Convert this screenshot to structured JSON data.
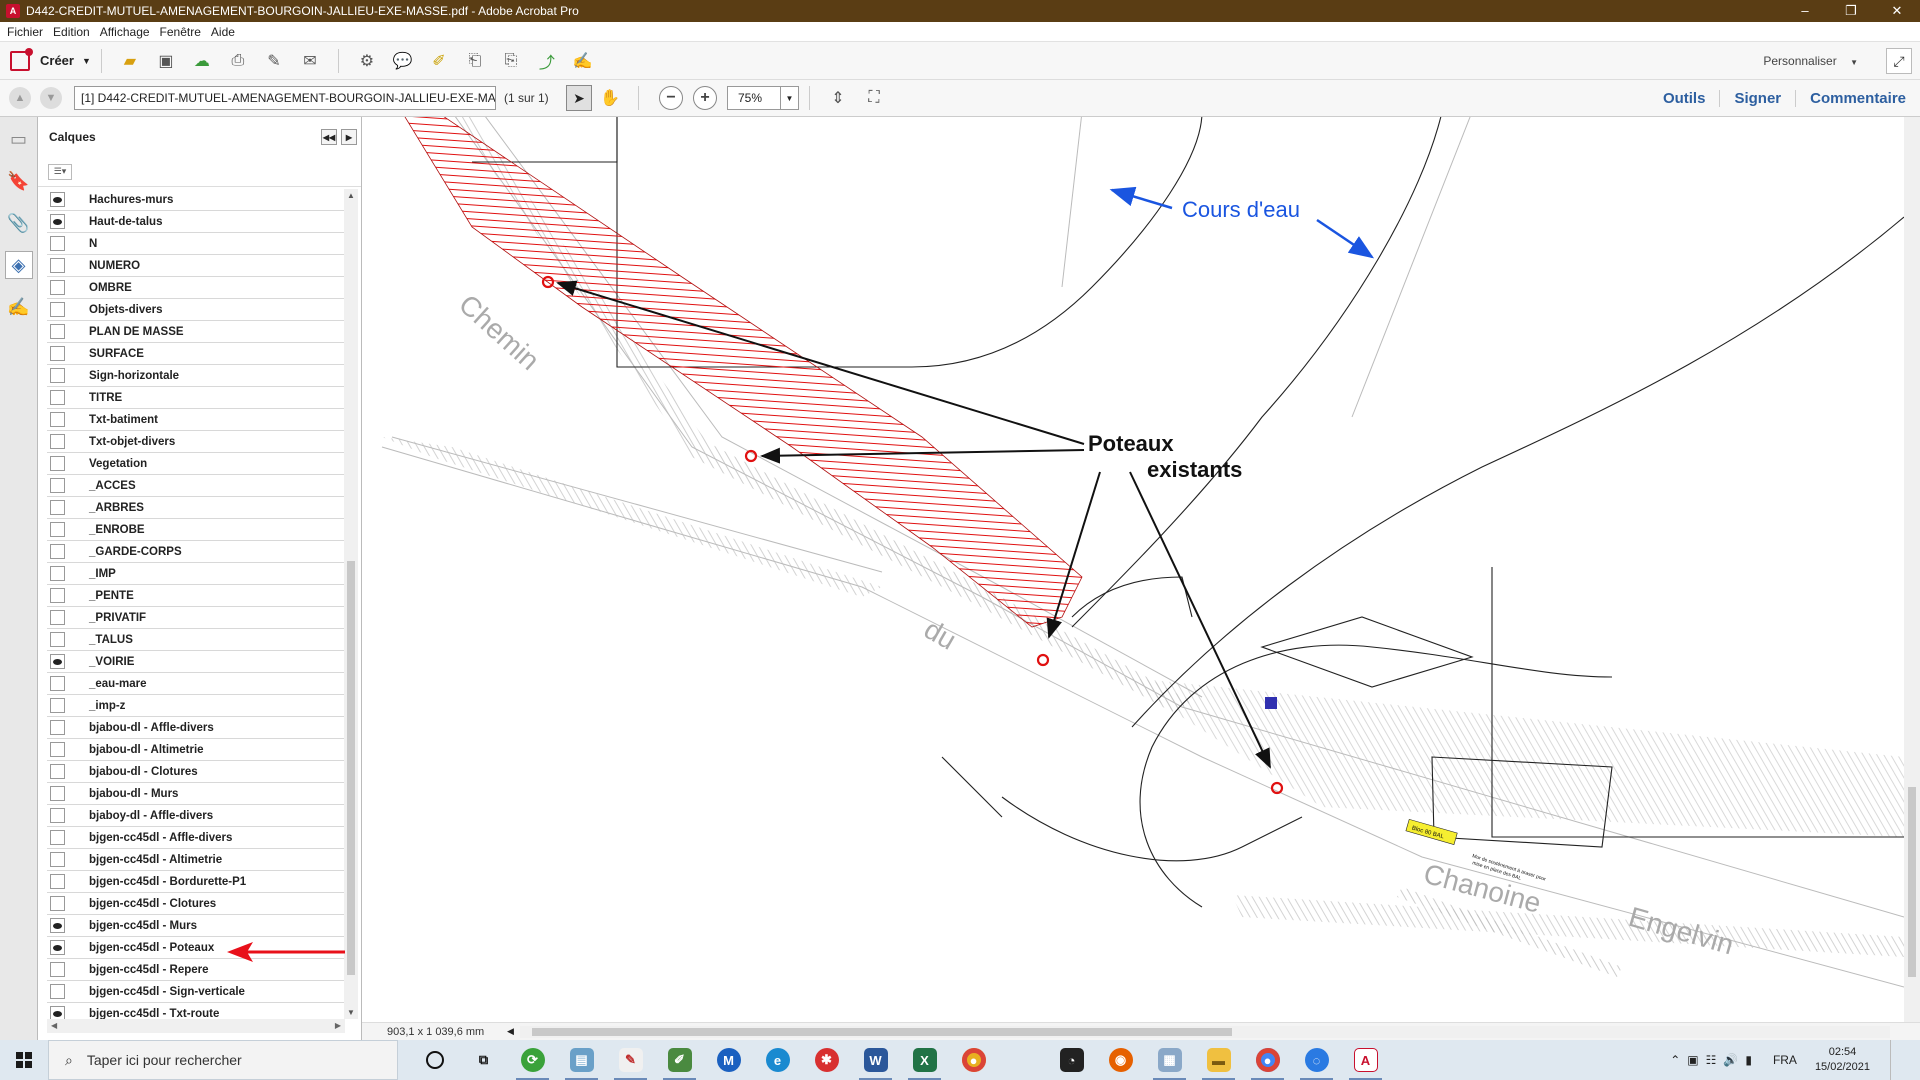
{
  "window": {
    "title": "D442-CREDIT-MUTUEL-AMENAGEMENT-BOURGOIN-JALLIEU-EXE-MASSE.pdf - Adobe Acrobat Pro",
    "controls": [
      "–",
      "❐",
      "✕"
    ]
  },
  "menu": [
    "Fichier",
    "Edition",
    "Affichage",
    "Fenêtre",
    "Aide"
  ],
  "toolbar": {
    "create_label": "Créer",
    "customize_label": "Personnaliser",
    "icons": [
      "open-icon",
      "save-icon",
      "upload-icon",
      "print-icon",
      "edit-icon",
      "email-icon",
      "settings-icon",
      "comment-icon",
      "highlight-icon",
      "stamp-icon",
      "export-icon",
      "sign-icon",
      "fill-icon"
    ]
  },
  "navbar": {
    "document_field": "[1] D442-CREDIT-MUTUEL-AMENAGEMENT-BOURGOIN-JALLIEU-EXE-MASSE",
    "page_count": "(1 sur 1)",
    "zoom": "75%",
    "links": [
      "Outils",
      "Signer",
      "Commentaire"
    ]
  },
  "layers_panel": {
    "title": "Calques",
    "layers": [
      {
        "name": "Hachures-murs",
        "visible": true
      },
      {
        "name": "Haut-de-talus",
        "visible": true
      },
      {
        "name": "N",
        "visible": false
      },
      {
        "name": "NUMERO",
        "visible": false
      },
      {
        "name": "OMBRE",
        "visible": false
      },
      {
        "name": "Objets-divers",
        "visible": false
      },
      {
        "name": "PLAN DE MASSE",
        "visible": false
      },
      {
        "name": "SURFACE",
        "visible": false
      },
      {
        "name": "Sign-horizontale",
        "visible": false
      },
      {
        "name": "TITRE",
        "visible": false
      },
      {
        "name": "Txt-batiment",
        "visible": false
      },
      {
        "name": "Txt-objet-divers",
        "visible": false
      },
      {
        "name": "Vegetation",
        "visible": false
      },
      {
        "name": "_ACCES",
        "visible": false
      },
      {
        "name": "_ARBRES",
        "visible": false
      },
      {
        "name": "_ENROBE",
        "visible": false
      },
      {
        "name": "_GARDE-CORPS",
        "visible": false
      },
      {
        "name": "_IMP",
        "visible": false
      },
      {
        "name": "_PENTE",
        "visible": false
      },
      {
        "name": "_PRIVATIF",
        "visible": false
      },
      {
        "name": "_TALUS",
        "visible": false
      },
      {
        "name": "_VOIRIE",
        "visible": true
      },
      {
        "name": "_eau-mare",
        "visible": false
      },
      {
        "name": "_imp-z",
        "visible": false
      },
      {
        "name": "bjabou-dl - Affle-divers",
        "visible": false
      },
      {
        "name": "bjabou-dl - Altimetrie",
        "visible": false
      },
      {
        "name": "bjabou-dl - Clotures",
        "visible": false
      },
      {
        "name": "bjabou-dl - Murs",
        "visible": false
      },
      {
        "name": "bjaboy-dl - Affle-divers",
        "visible": false
      },
      {
        "name": "bjgen-cc45dl - Affle-divers",
        "visible": false
      },
      {
        "name": "bjgen-cc45dl - Altimetrie",
        "visible": false
      },
      {
        "name": "bjgen-cc45dl - Bordurette-P1",
        "visible": false
      },
      {
        "name": "bjgen-cc45dl - Clotures",
        "visible": false
      },
      {
        "name": "bjgen-cc45dl - Murs",
        "visible": true
      },
      {
        "name": "bjgen-cc45dl - Poteaux",
        "visible": true
      },
      {
        "name": "bjgen-cc45dl - Repere",
        "visible": false
      },
      {
        "name": "bjgen-cc45dl - Sign-verticale",
        "visible": false
      },
      {
        "name": "bjgen-cc45dl - Txt-route",
        "visible": true
      }
    ]
  },
  "drawing": {
    "annotation_poteaux_line1": "Poteaux",
    "annotation_poteaux_line2": "existants",
    "annotation_cours_eau": "Cours d'eau",
    "street_word1": "Chemin",
    "street_word2": "du",
    "street_word3": "Chanoine",
    "street_word4": "Engelvin",
    "small_label": "Bloc 80 BAL",
    "small_note_line1": "Mur de soutènement à araser pour",
    "small_note_line2": "mise en place des BAL",
    "colors": {
      "hatch_red": "#e01010",
      "annotation_blue": "#1a55e0",
      "arrow_red": "#e8101a"
    }
  },
  "status": {
    "page_dimensions": "903,1 x 1 039,6 mm"
  },
  "taskbar": {
    "search_placeholder": "Taper ici pour rechercher",
    "language": "FRA",
    "time": "02:54",
    "date": "15/02/2021"
  }
}
